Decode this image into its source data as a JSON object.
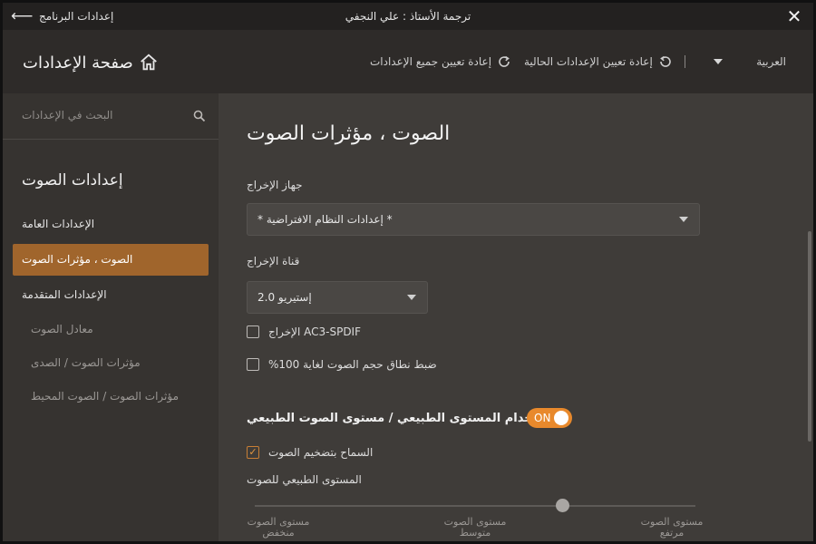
{
  "titlebar": {
    "program_settings": "إعدادات البرنامج",
    "title": "ترجمة الأستاذ : علي النجفي"
  },
  "header": {
    "page_title": "صفحة الإعدادات",
    "reset_all": "إعادة تعيين جميع الإعدادات",
    "reset_current": "إعادة تعيين الإعدادات الحالية",
    "language": "العربية"
  },
  "sidebar": {
    "search_placeholder": "البحث في الإعدادات",
    "section_title": "إعدادات الصوت",
    "items": [
      {
        "label": "الإعدادات العامة"
      },
      {
        "label": "الصوت ، مؤثرات الصوت"
      },
      {
        "label": "الإعدادات المتقدمة"
      },
      {
        "label": "معادل الصوت"
      },
      {
        "label": "مؤثرات الصوت / الصدى"
      },
      {
        "label": "مؤثرات الصوت / الصوت المحيط"
      }
    ]
  },
  "content": {
    "title": "الصوت ، مؤثرات الصوت",
    "output_device_label": "جهاز الإخراج",
    "output_device_value": "* إعدادات النظام الافتراضية *",
    "output_channel_label": "قناة الإخراج",
    "output_channel_value": "إستيريو 2.0",
    "ac3_spdif_label": "AC3-SPDIF الإخراج",
    "ac3_spdif_checked": false,
    "volume_range_label": "ضبط نطاق حجم الصوت لغاية 100%",
    "volume_range_checked": false,
    "normalize_label": "إستخدام المستوى الطبيعي / مستوى الصوت الطبيعي",
    "normalize_toggle": "ON",
    "amplify_label": "السماح بتضخيم الصوت",
    "amplify_checked": true,
    "normal_level_label": "المستوى الطبيعي للصوت",
    "slider_ticks": [
      {
        "line1": "مستوى الصوت",
        "line2": "منخفض"
      },
      {
        "line1": "مستوى الصوت",
        "line2": "متوسط"
      },
      {
        "line1": "مستوى الصوت",
        "line2": "مرتفع"
      }
    ],
    "slider_value_fraction": 0.7
  },
  "colors": {
    "accent": "#e8892c",
    "nav_active": "#a0652c"
  }
}
